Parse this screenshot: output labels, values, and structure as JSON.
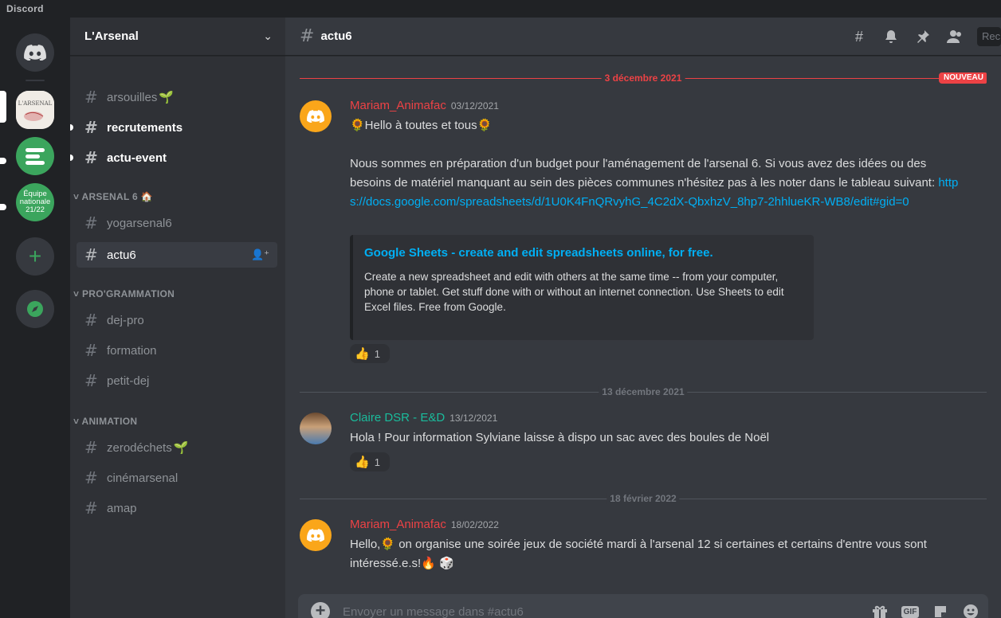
{
  "app": {
    "title": "Discord"
  },
  "guilds": {
    "arsenal_tile_text": "L'ARSENAL",
    "equipe_label": "Équipe nationale 21/22",
    "add_label": "+"
  },
  "server": {
    "name": "L'Arsenal"
  },
  "channels": [
    {
      "name": "arsouilles",
      "emoji": "🌱",
      "state": "normal"
    },
    {
      "name": "recrutements",
      "state": "unread"
    },
    {
      "name": "actu-event",
      "state": "unread"
    }
  ],
  "categories": [
    {
      "name": "ARSENAL 6",
      "emoji": "🏠",
      "channels": [
        {
          "name": "yogarsenal6"
        },
        {
          "name": "actu6",
          "active": true
        }
      ]
    },
    {
      "name": "PRO'GRAMMATION",
      "channels": [
        {
          "name": "dej-pro"
        },
        {
          "name": "formation"
        },
        {
          "name": "petit-dej"
        }
      ]
    },
    {
      "name": "ANIMATION",
      "channels": [
        {
          "name": "zerodéchets",
          "emoji": "🌱"
        },
        {
          "name": "cinémarsenal"
        },
        {
          "name": "amap"
        }
      ]
    }
  ],
  "header": {
    "channel": "actu6",
    "search_placeholder": "Rec"
  },
  "dividers": {
    "d1": "3 décembre 2021",
    "new_badge": "NOUVEAU",
    "d2": "13 décembre 2021",
    "d3": "18 février 2022"
  },
  "messages": [
    {
      "author": "Mariam_Animafac",
      "timestamp": "03/12/2021",
      "author_color": "#ed4245",
      "line1": "🌻Hello à toutes et tous🌻",
      "body_before_link": "Nous sommes en préparation d'un budget pour l'aménagement de l'arsenal 6. Si vous avez des idées ou des besoins de matériel manquant au sein des pièces communes n'hésitez pas à les noter dans le tableau suivant: ",
      "link": "https://docs.google.com/spreadsheets/d/1U0K4FnQRvyhG_4C2dX-QbxhzV_8hp7-2hhlueKR-WB8/edit#gid=0",
      "embed": {
        "title": "Google Sheets - create and edit spreadsheets online, for free.",
        "description": "Create a new spreadsheet and edit with others at the same time -- from your computer, phone or tablet. Get stuff done with or without an internet connection. Use Sheets to edit Excel files. Free from Google."
      },
      "reaction": {
        "emoji": "👍",
        "count": "1"
      }
    },
    {
      "author": "Claire DSR - E&D",
      "timestamp": "13/12/2021",
      "author_color": "#1abc9c",
      "text": "Hola ! Pour information Sylviane laisse à dispo un sac avec des boules de Noël",
      "reaction": {
        "emoji": "👍",
        "count": "1"
      }
    },
    {
      "author": "Mariam_Animafac",
      "timestamp": "18/02/2022",
      "author_color": "#ed4245",
      "text": "Hello,🌻  on organise une soirée jeux de société mardi à l'arsenal 12 si certaines et certains d'entre vous sont intéressé.e.s!🔥 🎲"
    }
  ],
  "composer": {
    "placeholder": "Envoyer un message dans #actu6",
    "gif_label": "GIF"
  }
}
